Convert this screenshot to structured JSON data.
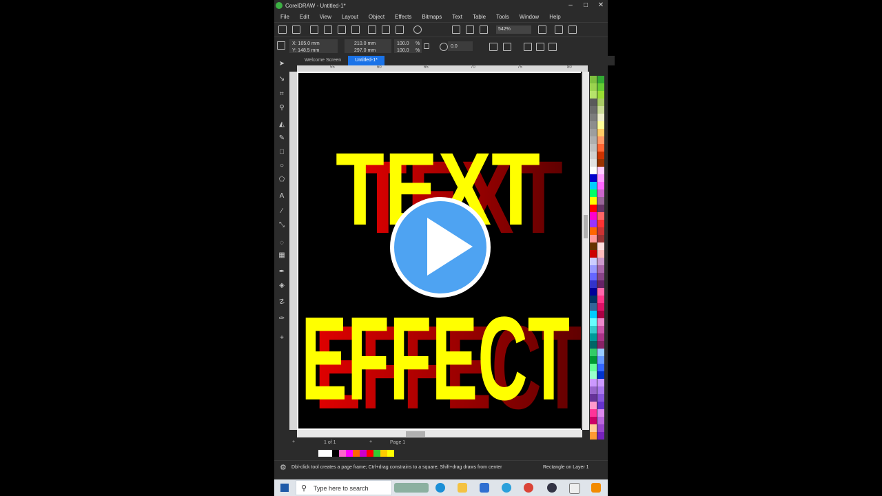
{
  "window": {
    "title": "CorelDRAW - Untitled-1*",
    "minimize": "–",
    "maximize": "□",
    "close": "✕"
  },
  "menu": [
    "File",
    "Edit",
    "View",
    "Layout",
    "Object",
    "Effects",
    "Bitmaps",
    "Text",
    "Table",
    "Tools",
    "Window",
    "Help"
  ],
  "toolbar": {
    "zoom": "542%"
  },
  "propbar": {
    "x": "X: 105.0 mm",
    "y": "Y: 148.5 mm",
    "w": "210.0 mm",
    "h": "297.0 mm",
    "scale_x": "100.0",
    "scale_y": "100.0",
    "pct_x": "%",
    "pct_y": "%",
    "angle": "0.0"
  },
  "tabs": [
    "Welcome Screen",
    "Untitled-1*"
  ],
  "ruler": {
    "top": [
      "55",
      "60",
      "65",
      "70",
      "75",
      "80"
    ],
    "left": [
      "225",
      "220",
      "115",
      "110",
      "105",
      "100",
      "95",
      "90",
      "175"
    ]
  },
  "artwork": {
    "line1": "TEXT",
    "line2": "EFFECT",
    "fill": "#ffff00",
    "extrude": "#e00000"
  },
  "pagebar": {
    "page_count": "1 of 1",
    "page_label": "Page 1",
    "add": "+"
  },
  "status": {
    "hint": "Dbl-click tool creates a page frame; Ctrl+drag constrains to a square; Shift+drag draws from center",
    "object": "Rectangle on Layer 1"
  },
  "taskbar": {
    "search_placeholder": "Type here to search"
  },
  "colors": {
    "accent": "#1a73e8",
    "play": "#4ea3f2"
  },
  "icons": [
    "pick-icon",
    "shape-icon",
    "crop-icon",
    "zoom-icon",
    "fill-icon",
    "brush-icon",
    "rectangle-icon",
    "ellipse-icon",
    "polygon-icon",
    "text-icon",
    "line-icon",
    "connector-icon",
    "shadow-icon",
    "transparency-icon",
    "eyedropper-icon",
    "smart-fill-icon",
    "smear-icon",
    "pen-icon",
    "play-icon",
    "windows-icon",
    "search-icon"
  ]
}
